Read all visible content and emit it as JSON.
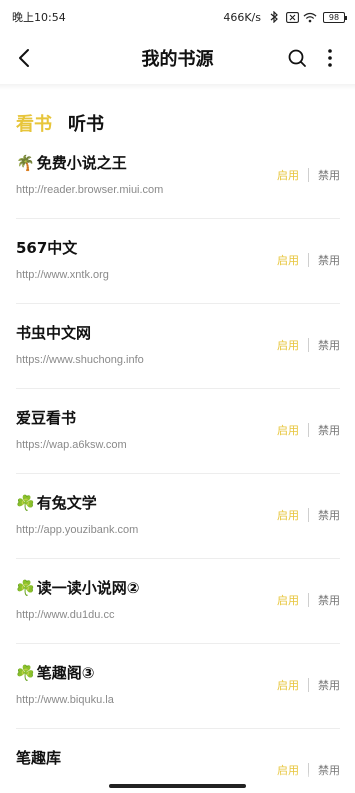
{
  "status_bar": {
    "time": "晚上10:54",
    "speed": "466K/s",
    "battery": "98"
  },
  "header": {
    "title": "我的书源"
  },
  "tabs": [
    {
      "label": "看书",
      "active": true
    },
    {
      "label": "听书",
      "active": false
    }
  ],
  "actions": {
    "enable_label": "启用",
    "disable_label": "禁用"
  },
  "sources": [
    {
      "icon": "🌴",
      "name": "免费小说之王",
      "url": "http://reader.browser.miui.com"
    },
    {
      "icon": "",
      "name": "567中文",
      "url": "http://www.xntk.org"
    },
    {
      "icon": "",
      "name": "书虫中文网",
      "url": "https://www.shuchong.info"
    },
    {
      "icon": "",
      "name": "爱豆看书",
      "url": "https://wap.a6ksw.com"
    },
    {
      "icon": "☘️",
      "name": "有兔文学",
      "url": "http://app.youzibank.com"
    },
    {
      "icon": "☘️",
      "name": "读一读小说网②",
      "url": "http://www.du1du.cc"
    },
    {
      "icon": "☘️",
      "name": "笔趣阁③",
      "url": "http://www.biquku.la"
    },
    {
      "icon": "",
      "name": "笔趣库",
      "url": ""
    }
  ],
  "colors": {
    "accent": "#e7c53a",
    "muted": "#8a8a8a"
  }
}
